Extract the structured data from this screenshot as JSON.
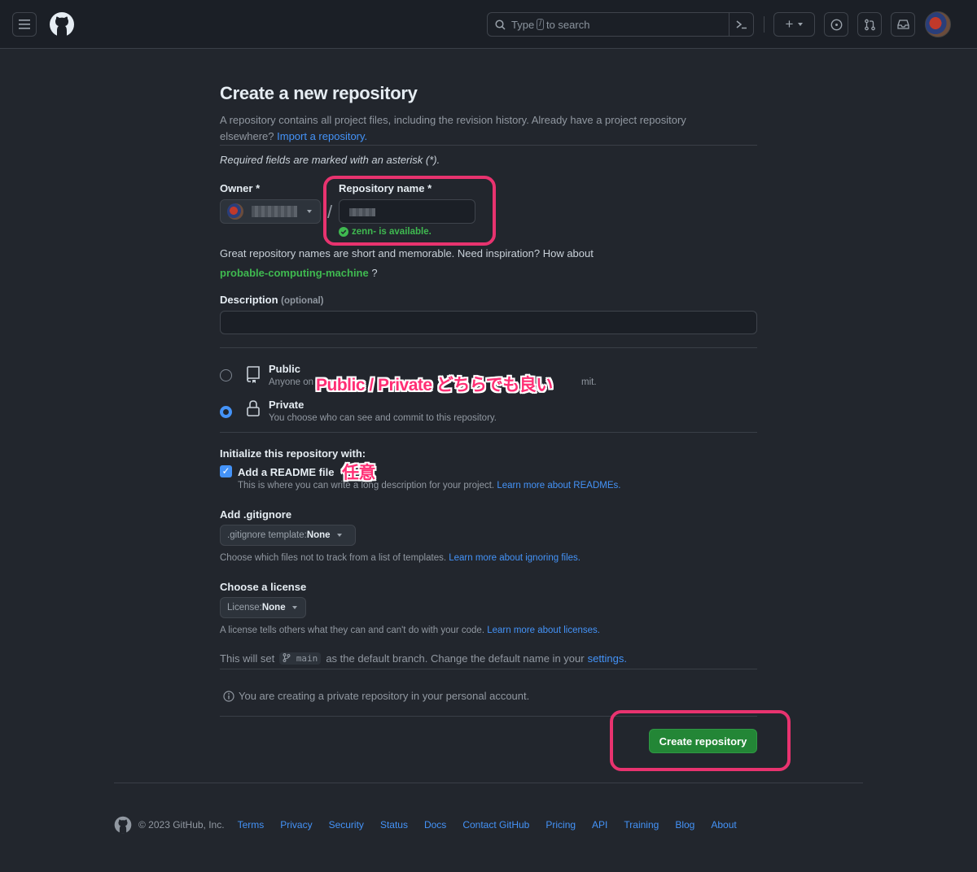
{
  "header": {
    "search_type": "Type",
    "search_slash": "/",
    "search_rest": "to search",
    "plus": "+"
  },
  "page": {
    "title": "Create a new repository",
    "intro_text": "A repository contains all project files, including the revision history. Already have a project repository elsewhere?",
    "import_link": "Import a repository.",
    "required_note": "Required fields are marked with an asterisk (*).",
    "owner_label": "Owner *",
    "separator": "/",
    "repo_name_label": "Repository name *",
    "availability": "zenn- is available.",
    "suggestion_text": "Great repository names are short and memorable. Need inspiration? How about",
    "suggestion_name": "probable-computing-machine",
    "suggestion_end": "?",
    "description_label": "Description",
    "description_optional": "(optional)",
    "visibility": {
      "public_title": "Public",
      "public_desc_start": "Anyone on",
      "public_desc_end": "mit.",
      "private_title": "Private",
      "private_desc": "You choose who can see and commit to this repository."
    },
    "init_label": "Initialize this repository with:",
    "readme_label": "Add a README file",
    "readme_desc": "This is where you can write a long description for your project.",
    "readme_link": "Learn more about READMEs.",
    "gitignore_label": "Add .gitignore",
    "gitignore_prefix": ".gitignore template:",
    "gitignore_value": "None",
    "gitignore_desc": "Choose which files not to track from a list of templates.",
    "gitignore_link": "Learn more about ignoring files.",
    "license_label": "Choose a license",
    "license_prefix": "License:",
    "license_value": "None",
    "license_desc": "A license tells others what they can and can't do with your code.",
    "license_link": "Learn more about licenses.",
    "branch_text_start": "This will set",
    "branch_name": "main",
    "branch_text_end": "as the default branch. Change the default name in your",
    "branch_link": "settings.",
    "private_notice": "You are creating a private repository in your personal account.",
    "create_button": "Create repository"
  },
  "annotations": {
    "visibility_note": "Public / Private どちらでも良い",
    "readme_note": "任意"
  },
  "footer": {
    "copyright": "© 2023 GitHub, Inc.",
    "links": [
      "Terms",
      "Privacy",
      "Security",
      "Status",
      "Docs",
      "Contact GitHub",
      "Pricing",
      "API",
      "Training",
      "Blog",
      "About"
    ]
  },
  "colors": {
    "background": "#22262d",
    "accent_blue": "#4493f8",
    "success_green": "#238636",
    "annotation_pink": "#e8336f"
  }
}
